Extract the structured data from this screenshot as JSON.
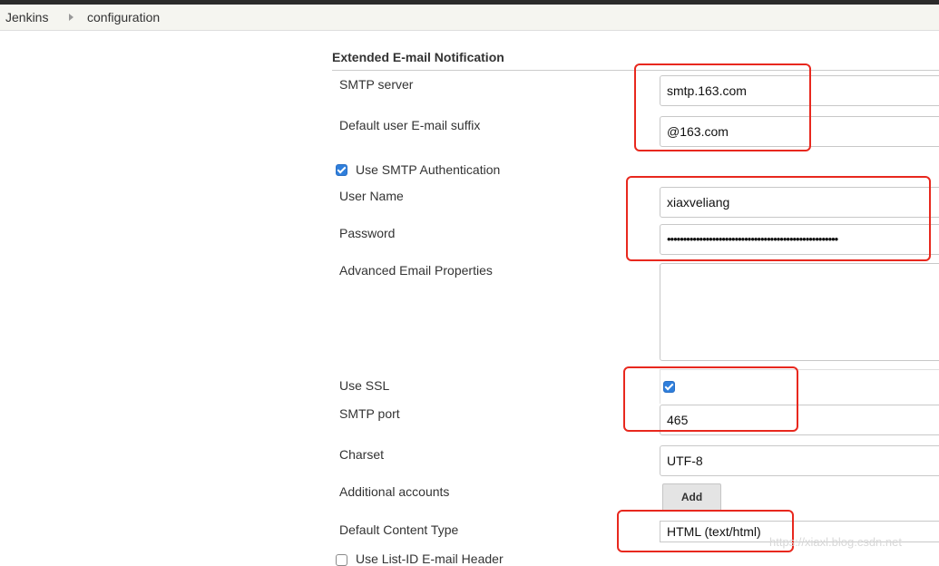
{
  "breadcrumb": {
    "items": [
      "Jenkins",
      "configuration"
    ]
  },
  "section": {
    "title": "Extended E-mail Notification"
  },
  "fields": {
    "smtp_server": {
      "label": "SMTP server",
      "value": "smtp.163.com"
    },
    "email_suffix": {
      "label": "Default user E-mail suffix",
      "value": "@163.com"
    },
    "use_smtp_auth": {
      "label": "Use SMTP Authentication",
      "checked": true
    },
    "user_name": {
      "label": "User Name",
      "value": "xiaxveliang"
    },
    "password": {
      "label": "Password",
      "value": "•••••••••••••••••••••••••••••••••••••••••••••••••••••"
    },
    "advanced_props": {
      "label": "Advanced Email Properties",
      "value": ""
    },
    "use_ssl": {
      "label": "Use SSL",
      "checked": true
    },
    "smtp_port": {
      "label": "SMTP port",
      "value": "465"
    },
    "charset": {
      "label": "Charset",
      "value": "UTF-8"
    },
    "additional_accounts": {
      "label": "Additional accounts",
      "button": "Add"
    },
    "content_type": {
      "label": "Default Content Type",
      "value": "HTML (text/html)"
    },
    "list_id_header": {
      "label": "Use List-ID E-mail Header",
      "checked": false
    }
  },
  "watermark": "https://xiaxl.blog.csdn.net",
  "colors": {
    "annotation": "#e8281e",
    "checkbox": "#2f7fdc",
    "topbar": "#2b2b2b"
  }
}
